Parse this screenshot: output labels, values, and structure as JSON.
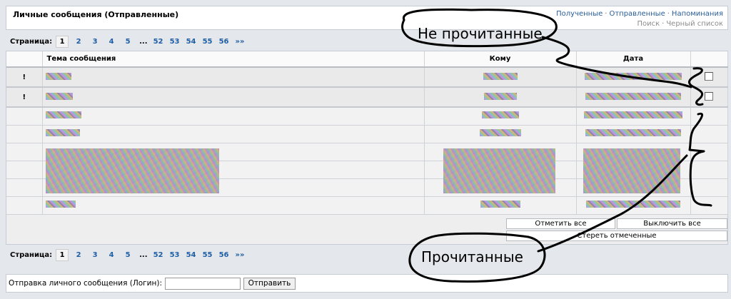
{
  "header": {
    "title": "Личные сообщения (Отправленные)",
    "links": [
      "Полученные",
      "Отправленные",
      "Напоминания"
    ],
    "sub_links": [
      "Поиск",
      "Черный список"
    ],
    "separator": "·"
  },
  "pager": {
    "label": "Страница:",
    "pages": [
      "1",
      "2",
      "3",
      "4",
      "5",
      "...",
      "52",
      "53",
      "54",
      "55",
      "56"
    ],
    "current": "1",
    "next": "»»"
  },
  "table": {
    "columns": [
      "Тема сообщения",
      "Кому",
      "Дата"
    ],
    "unread_mark": "!",
    "rows": [
      {
        "status": "unread",
        "mark": "!"
      },
      {
        "status": "unread",
        "mark": "!"
      },
      {
        "status": "read",
        "mark": ""
      },
      {
        "status": "read",
        "mark": ""
      },
      {
        "status": "read",
        "mark": ""
      },
      {
        "status": "read",
        "mark": ""
      },
      {
        "status": "read",
        "mark": ""
      },
      {
        "status": "read",
        "mark": ""
      }
    ]
  },
  "actions": {
    "mark_all": "Отметить все",
    "unmark_all": "Выключить все",
    "delete_marked": "Стереть отмеченные"
  },
  "send_form": {
    "label": "Отправка личного сообщения (Логин):",
    "input_value": "",
    "button": "Отправить"
  },
  "annotations": {
    "unread": "Не прочитанные",
    "read": "Прочитанные"
  },
  "colors": {
    "link": "#285d99",
    "page_link": "#1f5fa6",
    "background": "#e4e7eb"
  }
}
